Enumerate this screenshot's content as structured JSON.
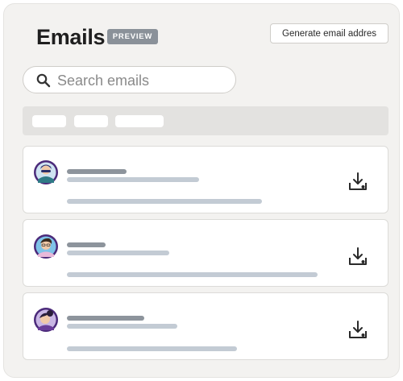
{
  "header": {
    "title": "Emails",
    "badge": "PREVIEW",
    "generate_button": "Generate email addres"
  },
  "search": {
    "placeholder": "Search emails",
    "icon": "search-icon"
  },
  "filters": {
    "chips": [
      "",
      "",
      ""
    ]
  },
  "emails": [
    {
      "avatar": "avatar-1",
      "action_icon": "download-icon"
    },
    {
      "avatar": "avatar-2",
      "action_icon": "download-icon"
    },
    {
      "avatar": "avatar-3",
      "action_icon": "download-icon"
    }
  ],
  "colors": {
    "card_background": "#f3f2f0",
    "badge_background": "#8a9199",
    "placeholder_bar_dark": "#8d949c",
    "placeholder_bar_light": "#c3cbd4",
    "avatar_ring": "#4b2a7a"
  }
}
